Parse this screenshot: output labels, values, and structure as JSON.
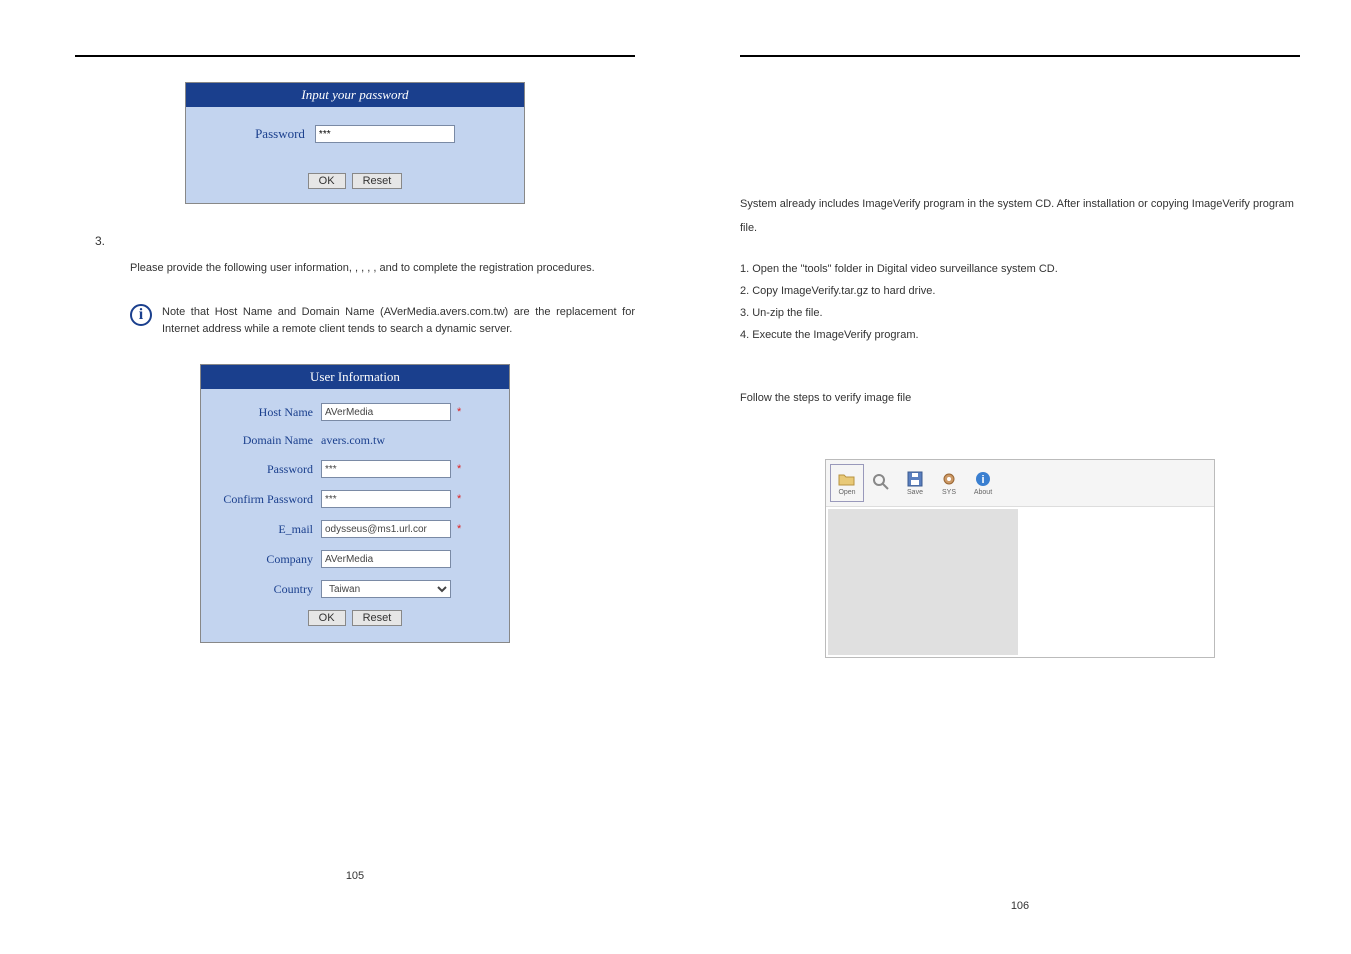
{
  "left_page": {
    "password_dialog": {
      "title": "Input your password",
      "password_label": "Password",
      "password_value": "***",
      "ok": "OK",
      "reset": "Reset"
    },
    "step_number": "3.",
    "step_text": "Please provide the following user information, , , , , and to complete the registration procedures.",
    "note_text": "Note that Host Name and Domain Name (AVerMedia.avers.com.tw) are the replacement for Internet address while a remote client tends to search a dynamic server.",
    "user_dialog": {
      "title": "User Information",
      "hostname_label": "Host Name",
      "hostname_value": "AVerMedia",
      "domain_label": "Domain Name",
      "domain_value": "avers.com.tw",
      "password_label": "Password",
      "password_value": "***",
      "confirm_label": "Confirm Password",
      "confirm_value": "***",
      "email_label": "E_mail",
      "email_value": "odysseus@ms1.url.cor",
      "company_label": "Company",
      "company_value": "AVerMedia",
      "country_label": "Country",
      "country_value": "Taiwan",
      "ok": "OK",
      "reset": "Reset"
    },
    "page_number": "105"
  },
  "right_page": {
    "intro_text": "System already includes ImageVerify program in the system CD. After installation or copying ImageVerify program file.",
    "steps": {
      "s1": "1. Open the \"tools\" folder in Digital video surveillance system CD.",
      "s2": "2. Copy ImageVerify.tar.gz to hard drive.",
      "s3": "3. Un-zip the file.",
      "s4": "4. Execute the ImageVerify program."
    },
    "follow_text": "Follow the steps to verify image file",
    "toolbar": {
      "open": "Open",
      "verify": "",
      "save": "Save",
      "sys": "SYS",
      "about": "About"
    },
    "page_number": "106"
  }
}
